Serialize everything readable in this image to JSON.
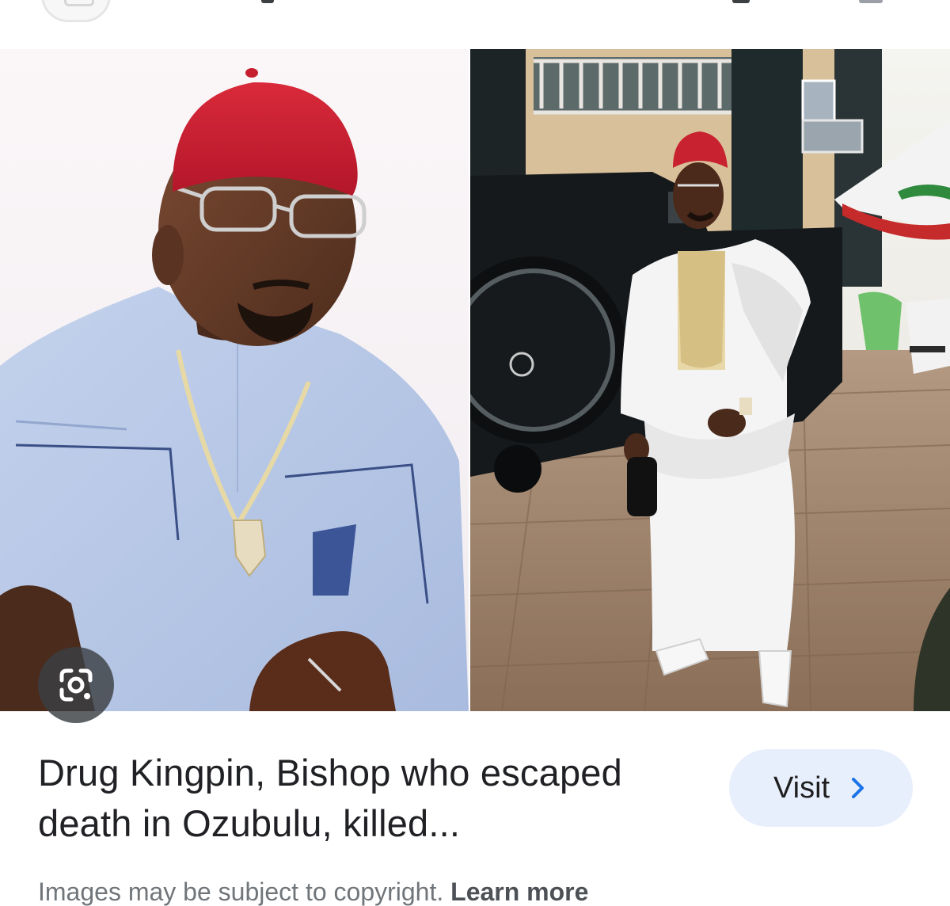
{
  "result": {
    "title": "Drug Kingpin, Bishop who escaped death in Ozubulu, killed...",
    "visit_label": "Visit",
    "lens_icon": "google-lens-icon",
    "chevron_icon": "chevron-right-icon"
  },
  "footer": {
    "copyright_text": "Images may be subject to copyright.",
    "learn_more": "Learn more"
  },
  "colors": {
    "visit_bg": "#e8effc",
    "title_text": "#202124",
    "muted_text": "#70757a",
    "accent_blue": "#1a73e8"
  }
}
